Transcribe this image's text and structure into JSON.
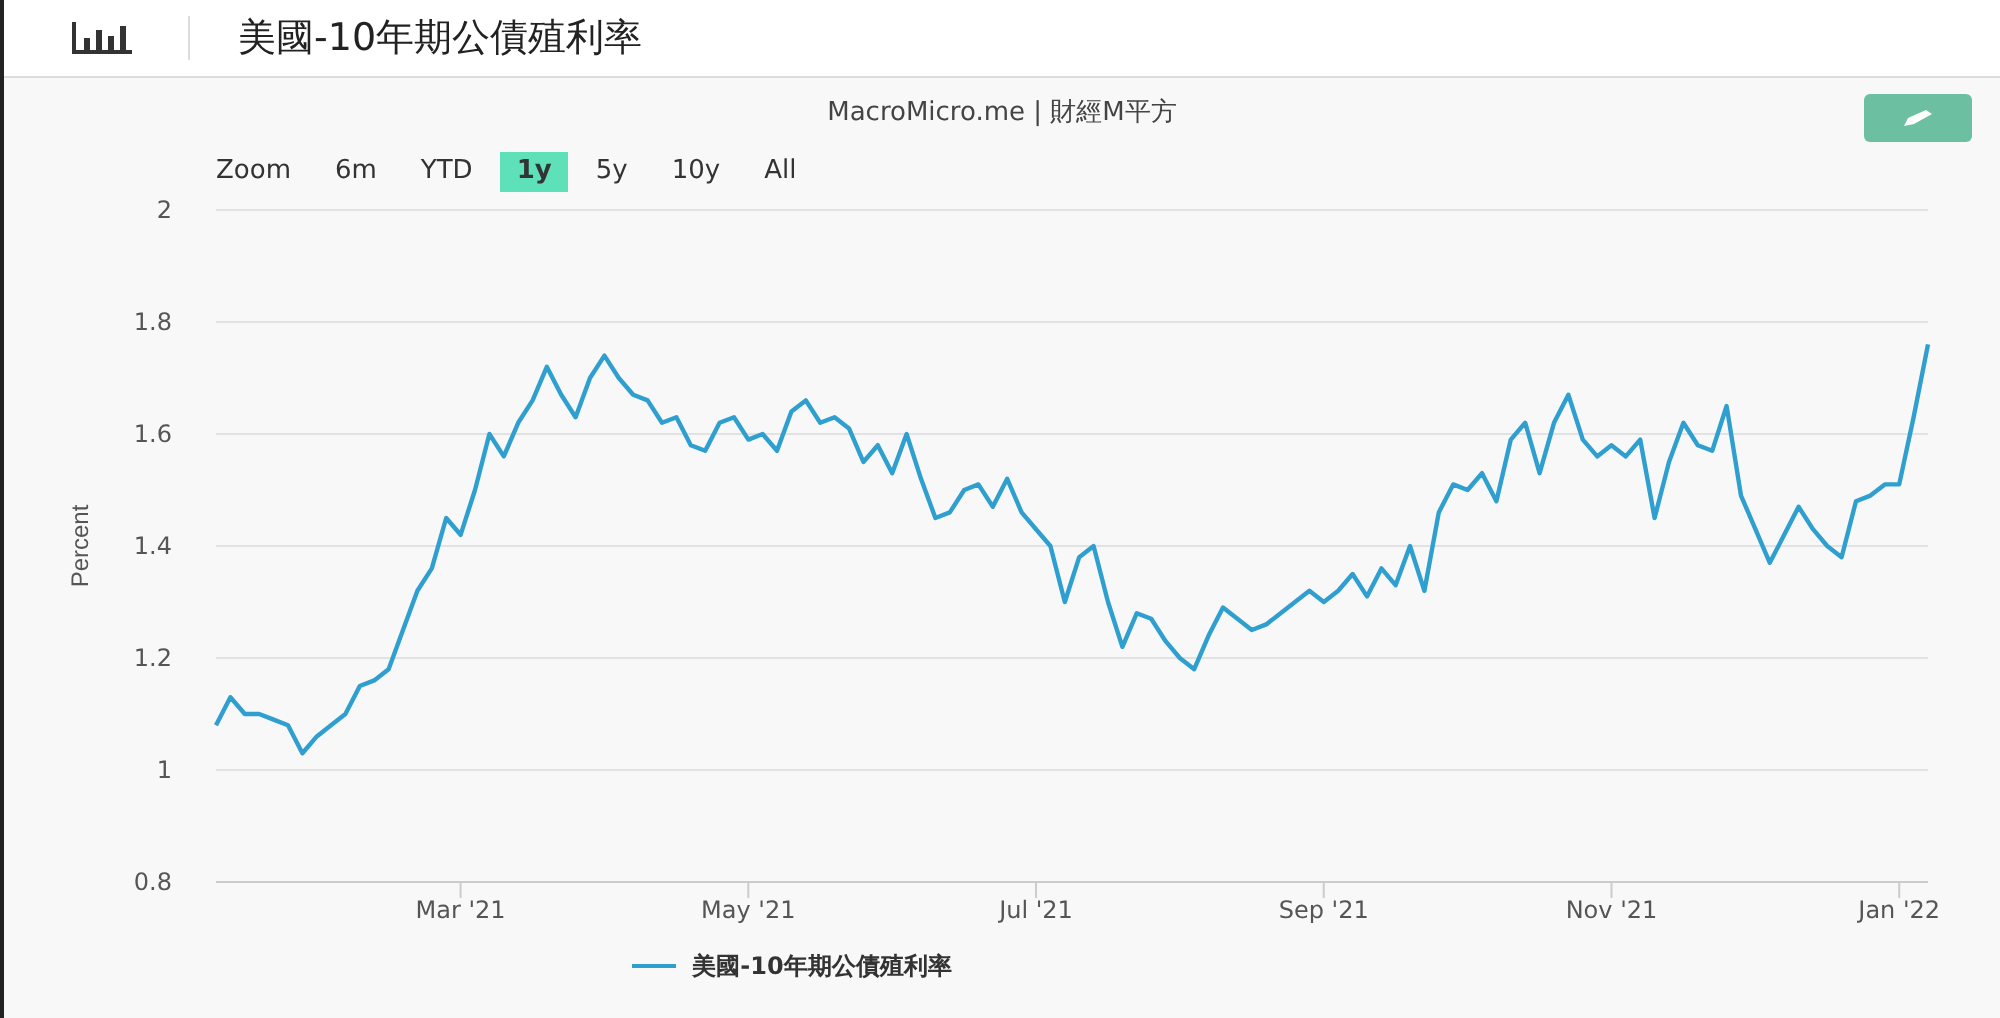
{
  "header": {
    "title": "美國-10年期公債殖利率"
  },
  "chart_panel": {
    "subtitle": "MacroMicro.me | 財經M平方",
    "range_selector": {
      "label": "Zoom",
      "options": [
        {
          "label": "6m",
          "selected": false
        },
        {
          "label": "YTD",
          "selected": false
        },
        {
          "label": "1y",
          "selected": true
        },
        {
          "label": "5y",
          "selected": false
        },
        {
          "label": "10y",
          "selected": false
        },
        {
          "label": "All",
          "selected": false
        }
      ]
    },
    "chart_data": {
      "type": "line",
      "grid": true,
      "ylabel": "Percent",
      "ylim": [
        0.8,
        2
      ],
      "yticks": [
        0.8,
        1,
        1.2,
        1.4,
        1.6,
        1.8,
        2
      ],
      "categories": [
        null,
        null,
        null,
        null,
        null,
        null,
        null,
        null,
        null,
        null,
        null,
        null,
        null,
        null,
        null,
        null,
        null,
        "Mar '21",
        null,
        null,
        null,
        null,
        null,
        null,
        null,
        null,
        null,
        null,
        null,
        null,
        null,
        null,
        null,
        null,
        null,
        null,
        null,
        "May '21",
        null,
        null,
        null,
        null,
        null,
        null,
        null,
        null,
        null,
        null,
        null,
        null,
        null,
        null,
        null,
        null,
        null,
        null,
        null,
        "Jul '21",
        null,
        null,
        null,
        null,
        null,
        null,
        null,
        null,
        null,
        null,
        null,
        null,
        null,
        null,
        null,
        null,
        null,
        null,
        null,
        "Sep '21",
        null,
        null,
        null,
        null,
        null,
        null,
        null,
        null,
        null,
        null,
        null,
        null,
        null,
        null,
        null,
        null,
        null,
        null,
        null,
        "Nov '21",
        null,
        null,
        null,
        null,
        null,
        null,
        null,
        null,
        null,
        null,
        null,
        null,
        null,
        null,
        null,
        null,
        null,
        null,
        null,
        "Jan '22",
        null,
        null
      ],
      "series": [
        {
          "name": "美國-10年期公債殖利率",
          "color": "#2f9fcf",
          "values": [
            1.08,
            1.13,
            1.1,
            1.1,
            1.09,
            1.08,
            1.03,
            1.06,
            1.08,
            1.1,
            1.15,
            1.16,
            1.18,
            1.25,
            1.32,
            1.36,
            1.45,
            1.42,
            1.5,
            1.6,
            1.56,
            1.62,
            1.66,
            1.72,
            1.67,
            1.63,
            1.7,
            1.74,
            1.7,
            1.67,
            1.66,
            1.62,
            1.63,
            1.58,
            1.57,
            1.62,
            1.63,
            1.59,
            1.6,
            1.57,
            1.64,
            1.66,
            1.62,
            1.63,
            1.61,
            1.55,
            1.58,
            1.53,
            1.6,
            1.52,
            1.45,
            1.46,
            1.5,
            1.51,
            1.47,
            1.52,
            1.46,
            1.43,
            1.4,
            1.3,
            1.38,
            1.4,
            1.3,
            1.22,
            1.28,
            1.27,
            1.23,
            1.2,
            1.18,
            1.24,
            1.29,
            1.27,
            1.25,
            1.26,
            1.28,
            1.3,
            1.32,
            1.3,
            1.32,
            1.35,
            1.31,
            1.36,
            1.33,
            1.4,
            1.32,
            1.46,
            1.51,
            1.5,
            1.53,
            1.48,
            1.59,
            1.62,
            1.53,
            1.62,
            1.67,
            1.59,
            1.56,
            1.58,
            1.56,
            1.59,
            1.45,
            1.55,
            1.62,
            1.58,
            1.57,
            1.65,
            1.49,
            1.43,
            1.37,
            1.42,
            1.47,
            1.43,
            1.4,
            1.38,
            1.48,
            1.49,
            1.51,
            1.51,
            1.63,
            1.76
          ]
        }
      ]
    }
  }
}
